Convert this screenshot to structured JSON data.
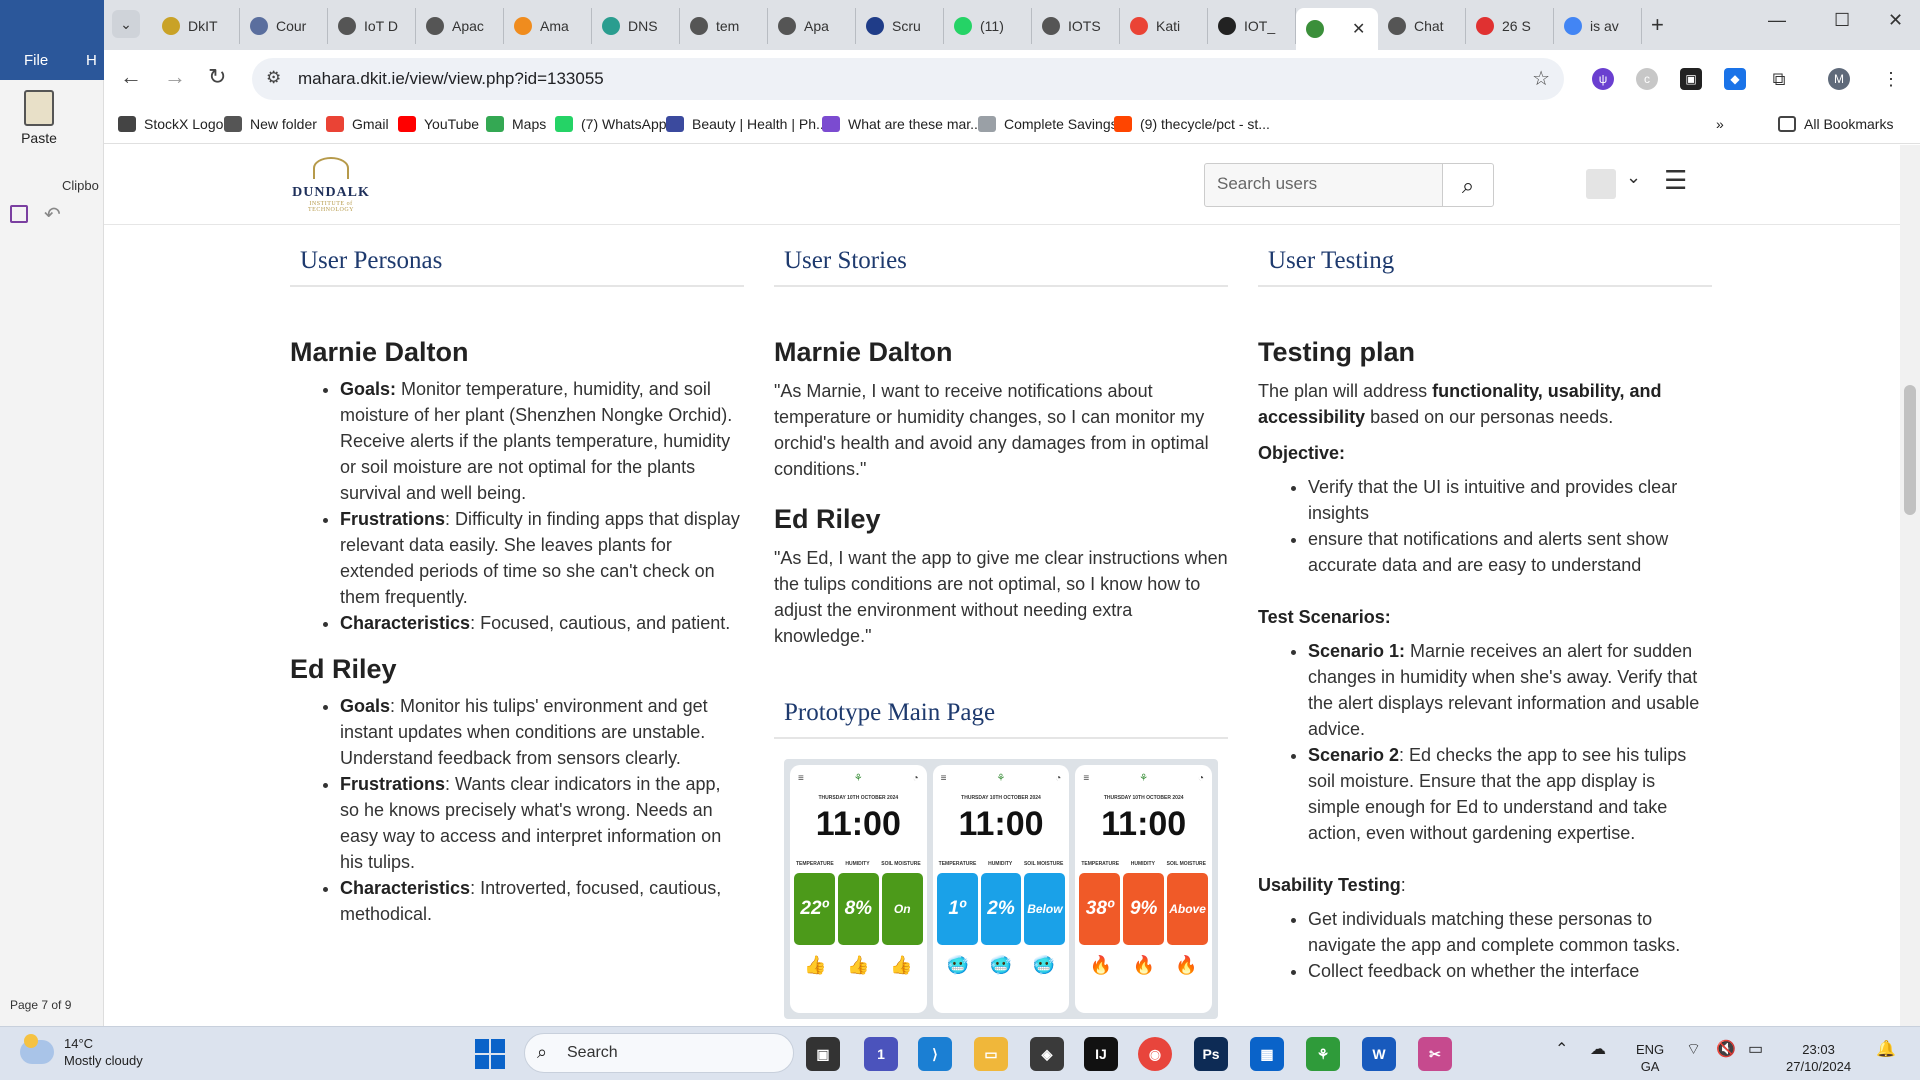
{
  "word": {
    "file_label": "File",
    "home_label": "H",
    "paste_label": "Paste",
    "clipboard_label": "Clipbo",
    "page_status": "Page 7 of 9"
  },
  "browser": {
    "tabs": [
      {
        "label": "DkIT",
        "color": "#c9a227"
      },
      {
        "label": "Cour",
        "color": "#5a6e9e"
      },
      {
        "label": "IoT D",
        "color": "#555555"
      },
      {
        "label": "Apac",
        "color": "#555555"
      },
      {
        "label": "Ama",
        "color": "#f08c1e"
      },
      {
        "label": "DNS",
        "color": "#2a9d8f"
      },
      {
        "label": "tem",
        "color": "#555555"
      },
      {
        "label": "Apa",
        "color": "#555555"
      },
      {
        "label": "Scru",
        "color": "#1f3c88"
      },
      {
        "label": "(11)",
        "color": "#25d366"
      },
      {
        "label": "IOTS",
        "color": "#555555"
      },
      {
        "label": "Kati",
        "color": "#ea4335"
      },
      {
        "label": "IOT_",
        "color": "#222222"
      }
    ],
    "active_tab_icon": "plant-icon",
    "tabs_after": [
      {
        "label": "Chat",
        "color": "#555555"
      },
      {
        "label": "26 S",
        "color": "#e03131"
      },
      {
        "label": "is av",
        "color": "#4285f4"
      }
    ],
    "url": "mahara.dkit.ie/view/view.php?id=133055",
    "profile_initial": "M",
    "bookmarks": [
      {
        "label": "StockX Logo",
        "color": "#444444"
      },
      {
        "label": "New folder",
        "color": "#555555"
      },
      {
        "label": "Gmail",
        "color": "#ea4335"
      },
      {
        "label": "YouTube",
        "color": "#ff0000"
      },
      {
        "label": "Maps",
        "color": "#34a853"
      },
      {
        "label": "(7) WhatsApp",
        "color": "#25d366"
      },
      {
        "label": "Beauty | Health | Ph...",
        "color": "#3b4a9e"
      },
      {
        "label": "What are these mar...",
        "color": "#7b4bd0"
      },
      {
        "label": "Complete Savings",
        "color": "#9aa0a6"
      },
      {
        "label": "(9) thecycle/pct - st...",
        "color": "#ff4500"
      }
    ],
    "all_bookmarks": "All Bookmarks"
  },
  "site": {
    "logo_name": "DUNDALK",
    "logo_sub": "INSTITUTE of TECHNOLOGY",
    "search_placeholder": "Search users"
  },
  "personas": {
    "title": "User Personas",
    "p1_name": "Marnie Dalton",
    "p1_goals_label": "Goals:",
    "p1_goals": " Monitor temperature, humidity, and soil moisture of her plant (Shenzhen Nongke Orchid). Receive alerts if the plants temperature, humidity or soil moisture are not optimal for the plants survival and well being.",
    "p1_frus_label": "Frustrations",
    "p1_frus": ": Difficulty in finding apps that display relevant data easily. She leaves plants for extended periods of time so she can't check on them frequently.",
    "p1_char_label": "Characteristics",
    "p1_char": ": Focused, cautious, and patient.",
    "p2_name": "Ed Riley",
    "p2_goals_label": "Goals",
    "p2_goals": ": Monitor his tulips' environment and get instant updates when conditions are unstable. Understand feedback from sensors clearly.",
    "p2_frus_label": "Frustrations",
    "p2_frus": ": Wants clear indicators in the app, so he knows precisely what's wrong. Needs an easy way to access and interpret information on his tulips.",
    "p2_char_label": "Characteristics",
    "p2_char": ": Introverted, focused, cautious, methodical."
  },
  "stories": {
    "title": "User Stories",
    "s1_name": "Marnie Dalton",
    "s1_text": "\"As Marnie, I want to receive notifications about temperature or humidity changes, so I can monitor my orchid's health and avoid any damages from in optimal conditions.\"",
    "s2_name": "Ed Riley",
    "s2_text": "\"As Ed, I want the app to give me clear instructions when the tulips conditions are not optimal, so I know how to adjust the environment without needing extra knowledge.\"",
    "proto_title": "Prototype Main Page",
    "phones": [
      {
        "time": "11:00",
        "date": "THURSDAY 10TH OCTOBER 2024",
        "temp": "22º",
        "hum": "8%",
        "soil": "On",
        "color": "#4c9a1a",
        "emoji": "👍"
      },
      {
        "time": "11:00",
        "date": "THURSDAY 10TH OCTOBER 2024",
        "temp": "1º",
        "hum": "2%",
        "soil": "Below",
        "color": "#1aa1e8",
        "emoji": "🥶"
      },
      {
        "time": "11:00",
        "date": "THURSDAY 10TH OCTOBER 2024",
        "temp": "38º",
        "hum": "9%",
        "soil": "Above",
        "color": "#f05a28",
        "emoji": "🔥"
      }
    ],
    "phone_labels": [
      "TEMPERATURE",
      "HUMIDITY",
      "SOIL MOISTURE"
    ]
  },
  "testing": {
    "title": "User Testing",
    "plan_title": "Testing plan",
    "plan_pre": "The plan will address ",
    "plan_bold": "functionality, usability, and accessibility",
    "plan_post": " based on our personas needs.",
    "objective_label": "Objective:",
    "objectives": [
      "Verify that the UI is intuitive and provides clear insights",
      "ensure that notifications and alerts sent show accurate data and are easy to understand"
    ],
    "scenarios_label": "Test Scenarios:",
    "sc1_label": "Scenario 1:",
    "sc1": " Marnie receives an alert for sudden changes in humidity when she's away. Verify that the alert displays relevant information and usable advice.",
    "sc2_label": "Scenario 2",
    "sc2": ": Ed checks the app to see his tulips soil moisture. Ensure that the app display is simple enough for Ed to understand and take action, even without gardening expertise.",
    "usability_label": "Usability Testing",
    "usability_colon": ":",
    "usability": [
      "Get individuals matching these personas to navigate the app and complete common tasks.",
      "Collect feedback on whether the interface"
    ]
  },
  "taskbar": {
    "temp": "14°C",
    "weather": "Mostly cloudy",
    "search": "Search",
    "lang1": "ENG",
    "lang2": "GA",
    "time": "23:03",
    "date": "27/10/2024",
    "teams_badge": "1"
  }
}
